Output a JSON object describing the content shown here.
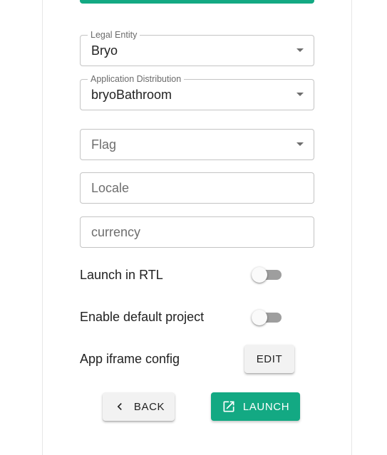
{
  "form": {
    "legal_entity": {
      "label": "Legal Entity",
      "value": "Bryo"
    },
    "application_distribution": {
      "label": "Application Distribution",
      "value": "bryoBathroom"
    },
    "flag": {
      "placeholder": "Flag"
    },
    "locale": {
      "placeholder": "Locale"
    },
    "currency": {
      "placeholder": "currency"
    },
    "launch_in_rtl": {
      "label": "Launch in RTL",
      "checked": false
    },
    "enable_default_project": {
      "label": "Enable default project",
      "checked": false
    },
    "app_iframe_config": {
      "label": "App iframe config",
      "edit_label": "EDIT"
    }
  },
  "actions": {
    "back_label": "BACK",
    "back_icon": "chevron-left-icon",
    "launch_label": "LAUNCH",
    "launch_icon": "open-in-new-icon"
  },
  "colors": {
    "accent": "#13a983",
    "switch_off_track": "#9e9e9e",
    "border": "#c4c4c4"
  }
}
